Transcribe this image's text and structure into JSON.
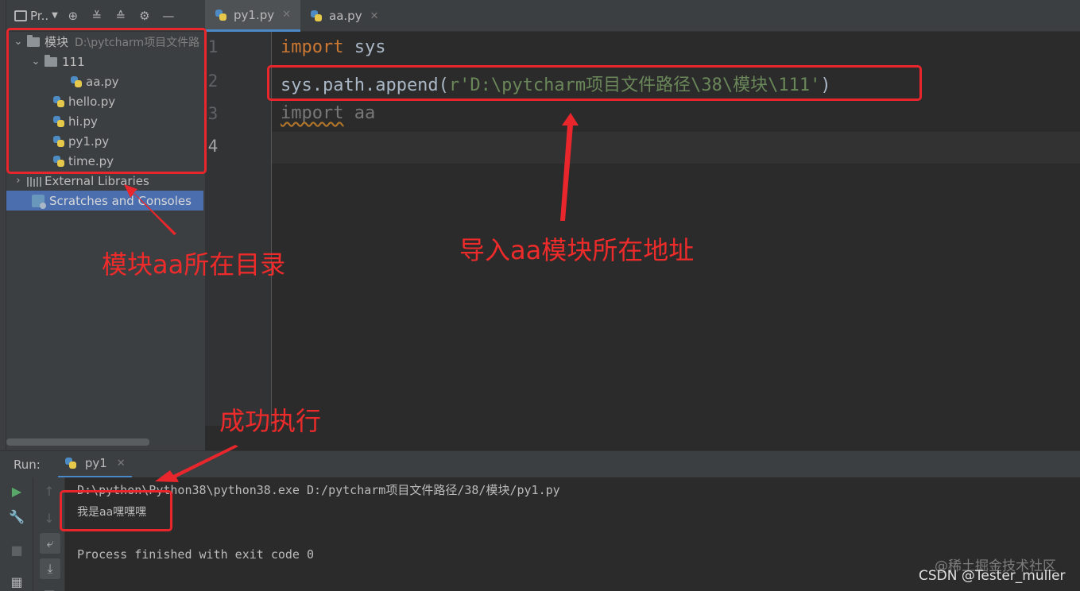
{
  "project_panel": {
    "title": "Pr..",
    "tree": {
      "root_label": "模块",
      "root_path": "D:\\pytcharm项目文件路",
      "folder_111": "111",
      "aa_file": "aa.py",
      "hello_file": "hello.py",
      "hi_file": "hi.py",
      "py1_file": "py1.py",
      "time_file": "time.py",
      "external_libraries": "External Libraries",
      "scratches": "Scratches and Consoles"
    }
  },
  "editor": {
    "tabs": [
      {
        "label": "py1.py",
        "active": true
      },
      {
        "label": "aa.py",
        "active": false
      }
    ],
    "line_numbers": [
      "1",
      "2",
      "3",
      "4"
    ],
    "code": {
      "line1_kw": "import",
      "line1_rest": " sys",
      "line2_prefix": "sys.path.append(",
      "line2_string": "r'D:\\pytcharm项目文件路径\\38\\模块\\111'",
      "line2_suffix": ")",
      "line3_kw": "import",
      "line3_rest": " aa"
    }
  },
  "run_panel": {
    "label": "Run:",
    "tab": "py1",
    "console": {
      "command": "D:\\python\\Python38\\python38.exe D:/pytcharm项目文件路径/38/模块/py1.py",
      "output": "我是aa嘿嘿嘿",
      "exit": "Process finished with exit code 0"
    }
  },
  "annotations": {
    "module_dir": "模块aa所在目录",
    "import_path": "导入aa模块所在地址",
    "success": "成功执行"
  },
  "watermark": {
    "line1": "@稀土掘金技术社区",
    "line2": "CSDN @Tester_muller"
  },
  "colors": {
    "keyword": "#cc7832",
    "string": "#6a8759",
    "annotation_red": "#e8262b",
    "selection": "#4b6eaf"
  }
}
